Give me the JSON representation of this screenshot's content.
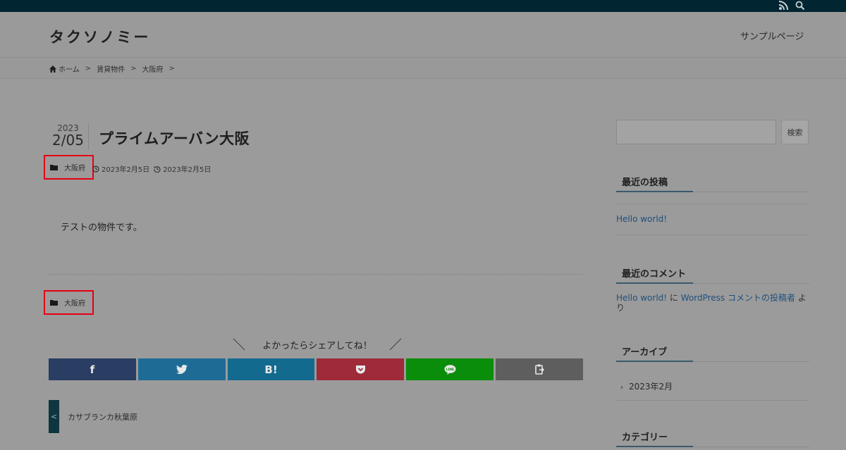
{
  "site": {
    "title": "タクソノミー",
    "nav_item": "サンプルページ"
  },
  "topbar": {
    "rss_icon": "rss-icon",
    "search_icon": "search-icon"
  },
  "breadcrumb": {
    "home": "ホーム",
    "items": [
      "賃貸物件",
      "大阪府"
    ],
    "separator": ">"
  },
  "post": {
    "year": "2023",
    "month_day": "2/05",
    "title": "プライムアーバン大阪",
    "category": "大阪府",
    "published": "2023年2月5日",
    "updated": "2023年2月5日",
    "body": "テストの物件です。"
  },
  "share": {
    "heading": "よかったらシェアしてね！",
    "slash_left": "＼",
    "slash_right": "／",
    "buttons": [
      {
        "name": "facebook",
        "label": "f",
        "color": "#2a3d62"
      },
      {
        "name": "twitter",
        "label": "🐦",
        "color": "#1e6c96"
      },
      {
        "name": "hatena",
        "label": "B!",
        "color": "#126b8f"
      },
      {
        "name": "pocket",
        "label": "pocket",
        "color": "#9e2a3a"
      },
      {
        "name": "line",
        "label": "LINE",
        "color": "#0a8d0a"
      },
      {
        "name": "copy",
        "label": "copy",
        "color": "#5e5e5e"
      }
    ]
  },
  "prev_post": {
    "arrow": "<",
    "title": "カサブランカ秋葉原"
  },
  "sidebar": {
    "search_button": "検索",
    "recent_posts_title": "最近の投稿",
    "recent_post": "Hello world!",
    "recent_comments_title": "最近のコメント",
    "comment": {
      "post": "Hello world!",
      "on": " に ",
      "author": "WordPress コメントの投稿者",
      "suffix": " より"
    },
    "archive_title": "アーカイブ",
    "archive_item": "2023年2月",
    "category_title": "カテゴリー"
  }
}
